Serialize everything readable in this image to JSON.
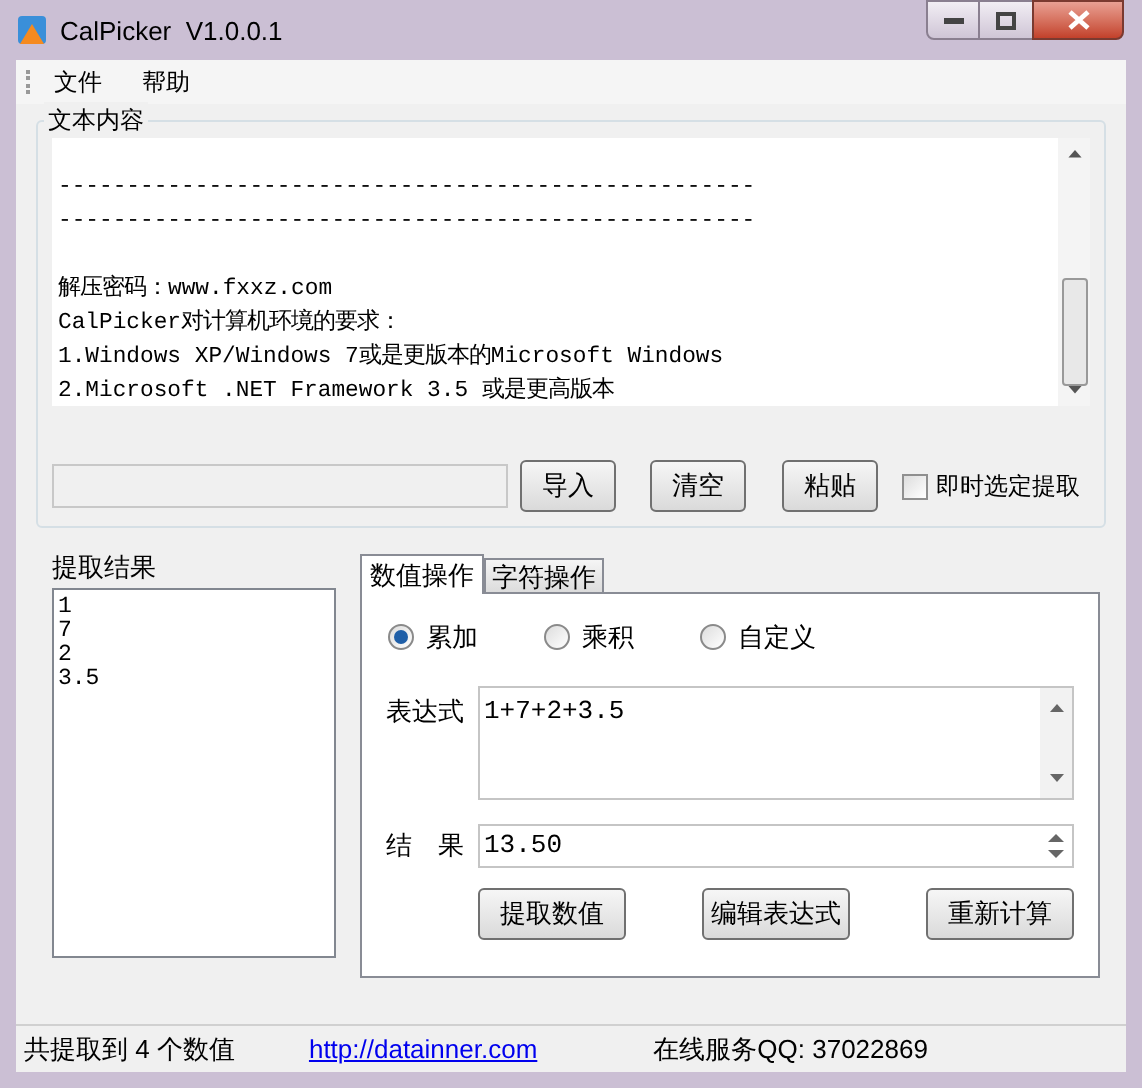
{
  "window": {
    "title": "CalPicker  V1.0.0.1"
  },
  "menu": [
    "文件",
    "帮助"
  ],
  "text_group": {
    "title": "文本内容",
    "paragraphs": [
      [
        "---------------------------------------------------",
        "---------------------------------------------------"
      ],
      [
        "解压密码：www.fxxz.com",
        "CalPicker对计算机环境的要求：",
        "1.Windows XP/Windows 7或是更版本的Microsoft Windows",
        "2.Microsoft .NET Framework 3.5 或是更高版本"
      ]
    ],
    "buttons": [
      "导入",
      "清空",
      "粘贴"
    ],
    "checkbox": {
      "label": "即时选定提取",
      "checked": false
    }
  },
  "results": {
    "title": "提取结果",
    "items": [
      "1",
      "7",
      "2",
      "3.5"
    ]
  },
  "tabs": [
    {
      "label": "数值操作",
      "selected": true
    },
    {
      "label": "字符操作",
      "selected": false
    }
  ],
  "radios": [
    {
      "label": "累加",
      "selected": true
    },
    {
      "label": "乘积",
      "selected": false
    },
    {
      "label": "自定义",
      "selected": false
    }
  ],
  "expression": {
    "label": "表达式",
    "value": "1+7+2+3.5"
  },
  "result": {
    "label": "结　果",
    "value": "13.50"
  },
  "actions": [
    "提取数值",
    "编辑表达式",
    "重新计算"
  ],
  "status_bar": {
    "count": "共提取到 4 个数值",
    "link": "http://datainner.com",
    "contact": "在线服务QQ: 37022869"
  }
}
